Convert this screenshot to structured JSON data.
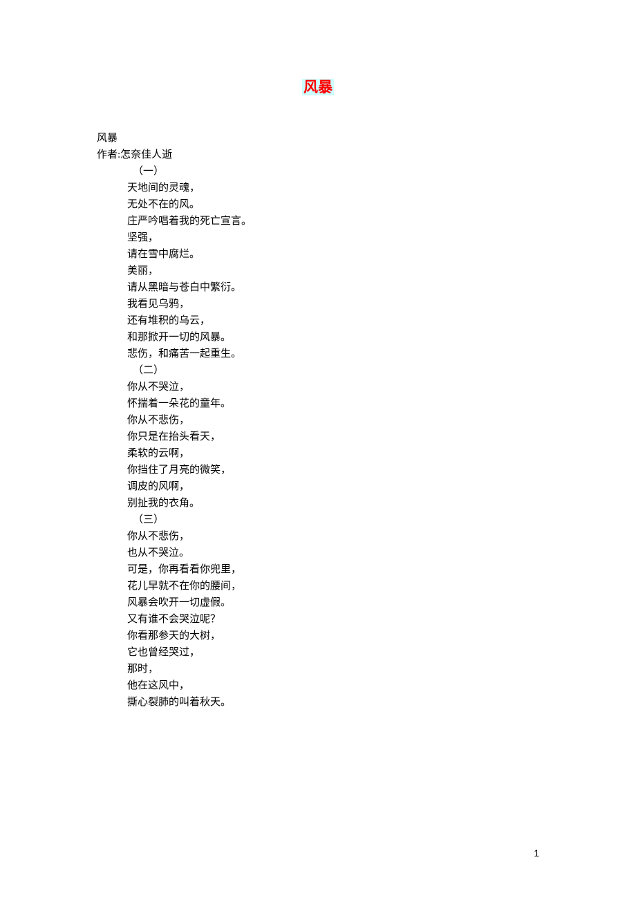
{
  "title": "风暴",
  "meta": {
    "poem_title": "风暴",
    "author_label": "作者:怎奈佳人逝"
  },
  "sections": {
    "s1": "（一）",
    "s2": "（二）",
    "s3": "（三）"
  },
  "lines": {
    "l1": "天地间的灵魂，",
    "l2": "无处不在的风。",
    "l3": "庄严吟唱着我的死亡宣言。",
    "l4": "坚强，",
    "l5": "请在雪中腐烂。",
    "l6": "美丽，",
    "l7": "请从黑暗与苍白中繁衍。",
    "l8": "我看见乌鸦，",
    "l9": "还有堆积的乌云，",
    "l10": "和那掀开一切的风暴。",
    "l11": "悲伤，和痛苦一起重生。",
    "l12": "你从不哭泣，",
    "l13": "怀揣着一朵花的童年。",
    "l14": "你从不悲伤，",
    "l15": "你只是在抬头看天，",
    "l16": "柔软的云啊，",
    "l17": "你挡住了月亮的微笑，",
    "l18": "调皮的风啊，",
    "l19": "别扯我的衣角。",
    "l20": "你从不悲伤，",
    "l21": "也从不哭泣。",
    "l22": "可是，你再看看你兜里，",
    "l23": "花儿早就不在你的腰间，",
    "l24": "风暴会吹开一切虚假。",
    "l25": "又有谁不会哭泣呢？",
    "l26": "你看那参天的大树，",
    "l27": "它也曾经哭过，",
    "l28": "那时，",
    "l29": "他在这风中，",
    "l30": "撕心裂肺的叫着秋天。"
  },
  "page_number": "1"
}
